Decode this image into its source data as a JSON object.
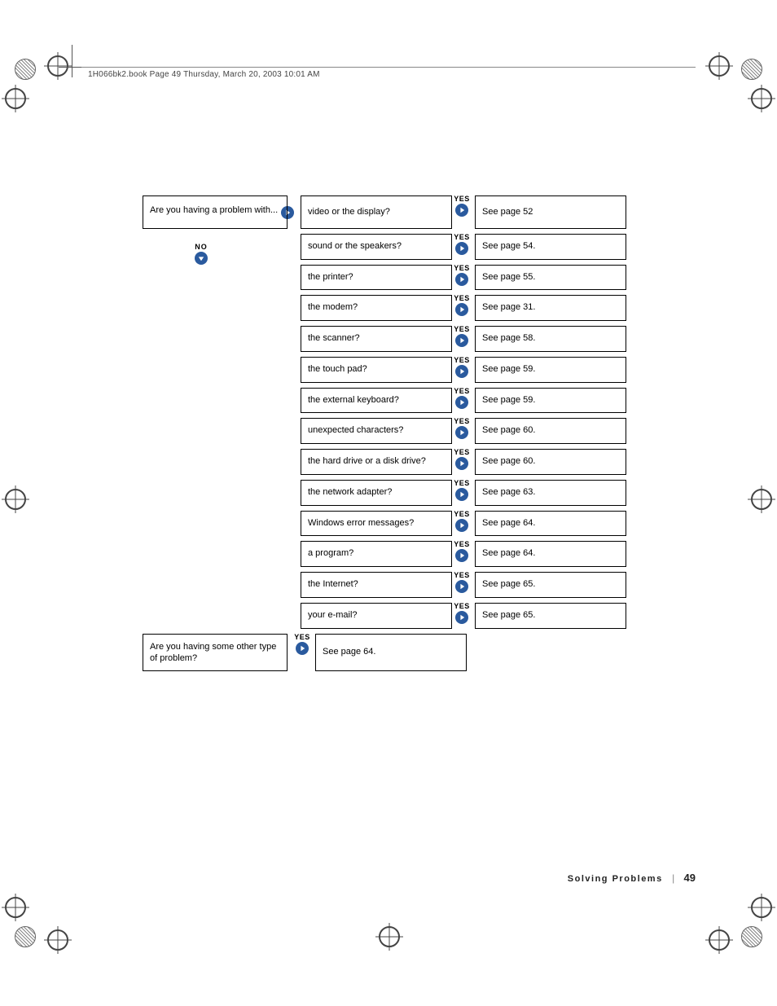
{
  "header_text": "1H066bk2.book  Page 49  Thursday, March 20, 2003  10:01 AM",
  "labels": {
    "yes": "YES",
    "no": "NO"
  },
  "intro_question": "Are you having a problem with...",
  "rows": [
    {
      "q": "video or the display?",
      "a": "See page 52"
    },
    {
      "q": "sound or the speakers?",
      "a": "See page 54."
    },
    {
      "q": "the printer?",
      "a": "See page 55."
    },
    {
      "q": "the modem?",
      "a": "See page 31."
    },
    {
      "q": "the scanner?",
      "a": "See page 58."
    },
    {
      "q": "the touch pad?",
      "a": "See page 59."
    },
    {
      "q": "the external keyboard?",
      "a": "See page 59."
    },
    {
      "q": "unexpected characters?",
      "a": "See page 60."
    },
    {
      "q": "the hard drive or a disk drive?",
      "a": "See page 60."
    },
    {
      "q": "the network adapter?",
      "a": "See page 63."
    },
    {
      "q": "Windows error messages?",
      "a": "See page 64."
    },
    {
      "q": "a program?",
      "a": "See page 64."
    },
    {
      "q": "the Internet?",
      "a": "See page 65."
    },
    {
      "q": "your e-mail?",
      "a": "See page 65."
    }
  ],
  "other": {
    "q": "Are you having some other type of problem?",
    "a": "See page 64."
  },
  "footer": {
    "section": "Solving Problems",
    "page": "49"
  }
}
